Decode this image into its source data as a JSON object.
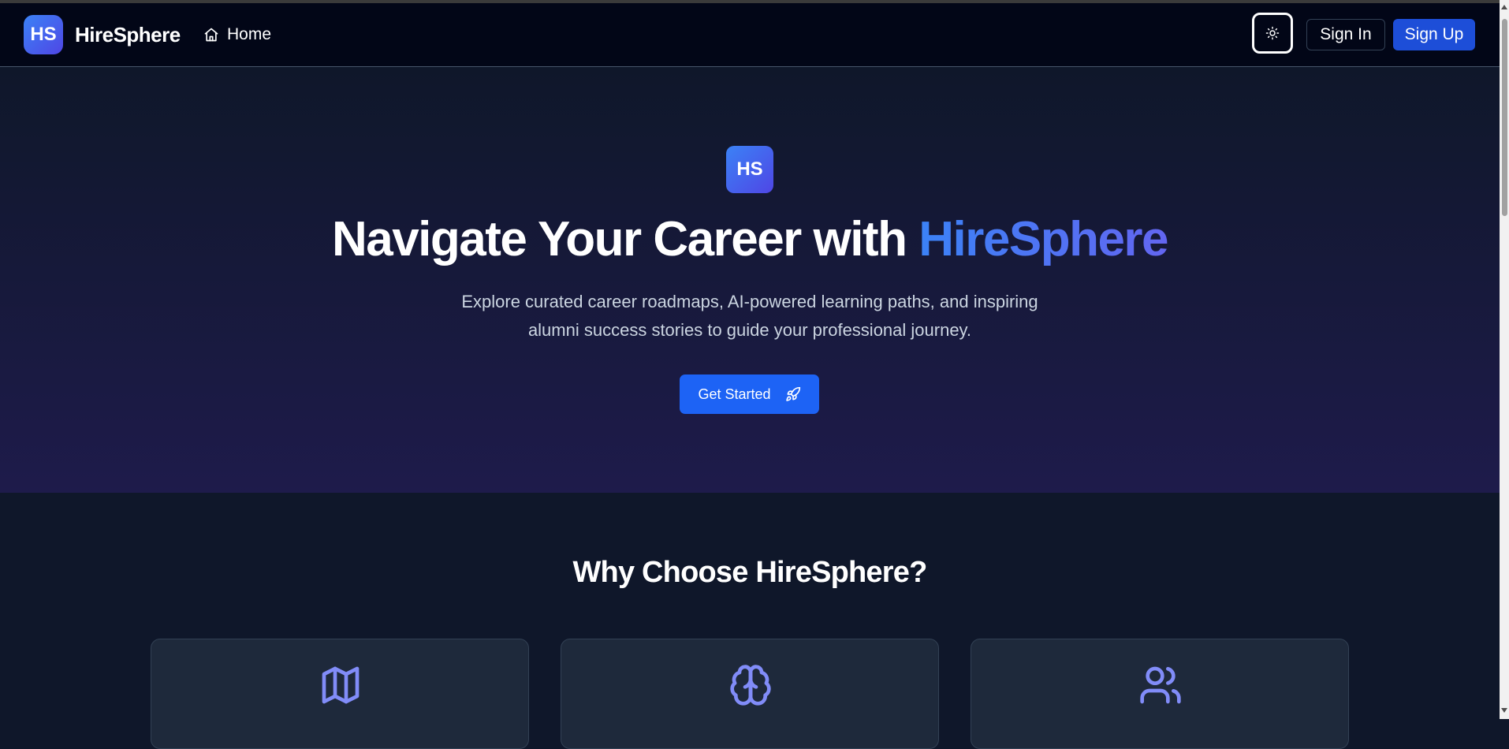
{
  "navbar": {
    "logo_text": "HS",
    "brand_name": "HireSphere",
    "home_label": "Home",
    "home_icon": "home-icon",
    "theme_icon": "sun-icon",
    "signin_label": "Sign In",
    "signup_label": "Sign Up"
  },
  "hero": {
    "logo_text": "HS",
    "title_main": "Navigate Your Career with ",
    "title_accent": "HireSphere",
    "subtitle_line1": "Explore curated career roadmaps, AI-powered learning paths, and inspiring",
    "subtitle_line2": "alumni success stories to guide your professional journey.",
    "cta_label": "Get Started",
    "cta_icon": "rocket-icon"
  },
  "features": {
    "title": "Why Choose HireSphere?",
    "cards": [
      {
        "icon": "map-icon"
      },
      {
        "icon": "brain-icon"
      },
      {
        "icon": "users-icon"
      }
    ]
  },
  "colors": {
    "navbar_bg": "#020617",
    "page_bg": "#0f172a",
    "accent_blue": "#1d4ed8",
    "cta_blue": "#1d63f5",
    "icon_purple": "#818cf8"
  }
}
